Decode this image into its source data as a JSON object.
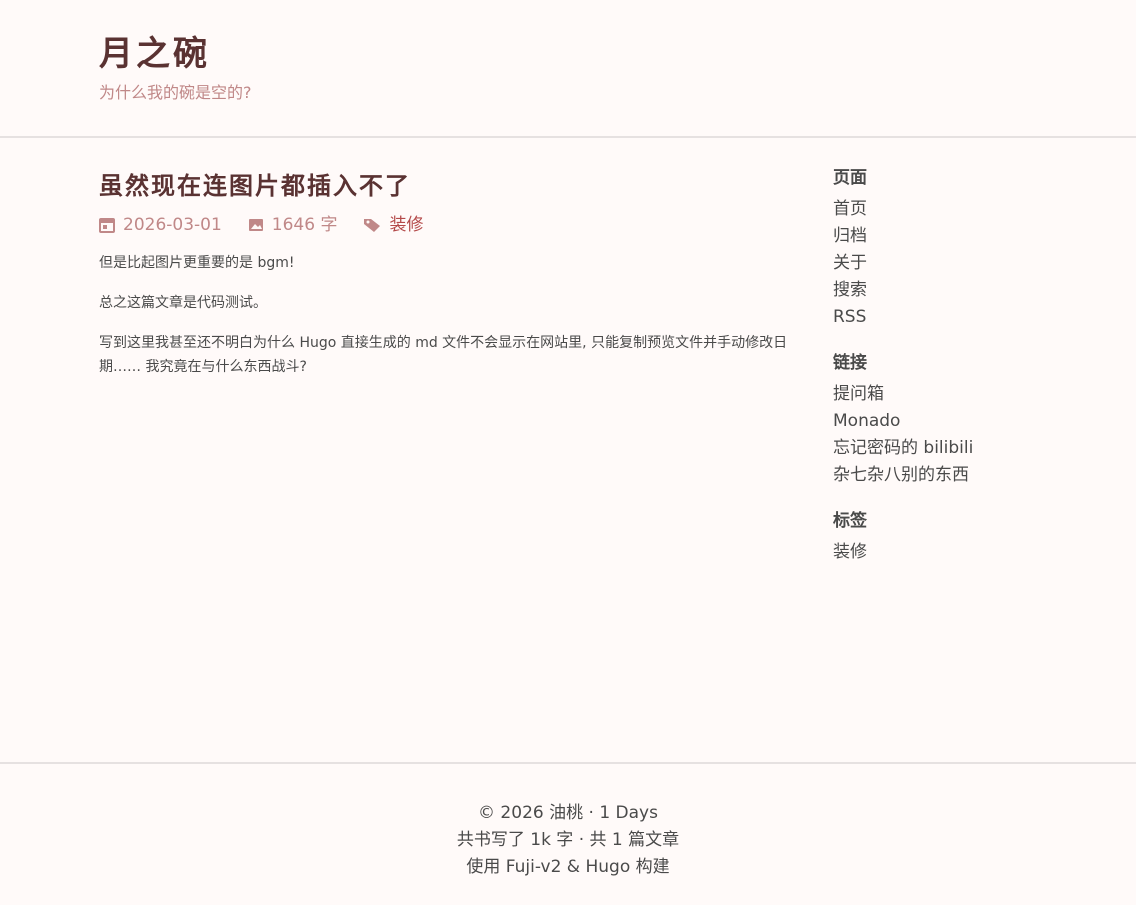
{
  "site": {
    "title": "月之碗",
    "subtitle": "为什么我的碗是空的?"
  },
  "post": {
    "title": "虽然现在连图片都插入不了",
    "date": "2026-03-01",
    "word_count": "1646 字",
    "tag": "装修",
    "paragraphs": [
      "但是比起图片更重要的是 bgm!",
      "总之这篇文章是代码测试。",
      "写到这里我甚至还不明白为什么 Hugo 直接生成的 md 文件不会显示在网站里, 只能复制预览文件并手动修改日期…… 我究竟在与什么东西战斗?"
    ]
  },
  "sidebar": {
    "pages_heading": "页面",
    "pages": [
      "首页",
      "归档",
      "关于",
      "搜索",
      "RSS"
    ],
    "links_heading": "链接",
    "links": [
      "提问箱",
      "Monado",
      "忘记密码的 bilibili",
      "杂七杂八别的东西"
    ],
    "tags_heading": "标签",
    "tags": [
      "装修"
    ]
  },
  "footer": {
    "line1": "© 2026 油桃 · 1 Days",
    "line2": "共书写了 1k 字 · 共 1 篇文章",
    "line3": "使用 Fuji-v2 & Hugo 构建"
  },
  "colors": {
    "background": "#fffaf9",
    "title": "#5a3232",
    "accent": "#c08888",
    "tag": "#b44a4a"
  },
  "icons": {
    "date": "calendar-icon",
    "words": "image-icon",
    "tag": "tag-icon"
  }
}
